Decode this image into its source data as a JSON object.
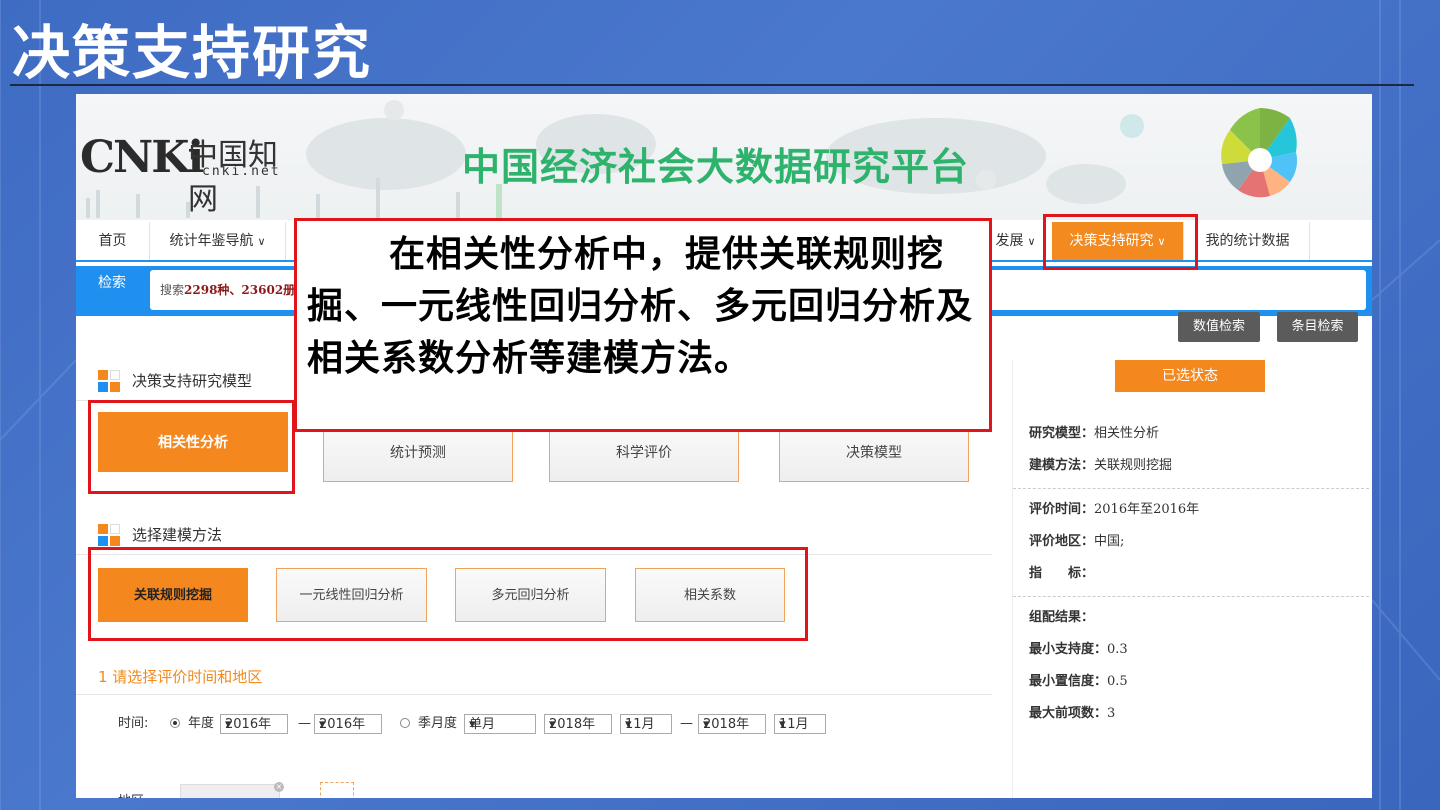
{
  "slide": {
    "title": "决策支持研究"
  },
  "banner": {
    "logo_text": "CNKi",
    "logo_cn": "中国知网",
    "logo_url": "cnki.net",
    "platform_title": "中国经济社会大数据研究平台"
  },
  "nav": {
    "items": [
      {
        "label": "首页",
        "chevron": false
      },
      {
        "label": "统计年鉴导航",
        "chevron": true
      },
      {
        "label": "发展",
        "chevron": true
      },
      {
        "label": "决策支持研究",
        "chevron": true
      },
      {
        "label": "我的统计数据",
        "chevron": false
      }
    ]
  },
  "search": {
    "tab_label": "检索",
    "prefix": "搜索",
    "stats": "2298种、23602册"
  },
  "buttons": {
    "value_search": "数值检索",
    "entry_search": "条目检索"
  },
  "models": {
    "section_title": "决策支持研究模型",
    "items": [
      "相关性分析",
      "统计预测",
      "科学评价",
      "决策模型"
    ]
  },
  "methods": {
    "section_title": "选择建模方法",
    "items": [
      "关联规则挖掘",
      "一元线性回归分析",
      "多元回归分析",
      "相关系数"
    ]
  },
  "step1": {
    "title": "1  请选择评价时间和地区",
    "time_label": "时间:",
    "year_label": "年度",
    "year_from": "2016年",
    "year_to": "2016年",
    "season_label": "季月度",
    "month_type": "单月",
    "s_year_from": "2018年",
    "s_month_from": "11月",
    "s_year_to": "2018年",
    "s_month_to": "11月",
    "dash": "—",
    "region_label": "地区:"
  },
  "status": {
    "header": "已选状态",
    "model_label": "研究模型：",
    "model_value": "相关性分析",
    "method_label": "建模方法：",
    "method_value": "关联规则挖掘",
    "time_label": "评价时间：",
    "time_value": "2016年至2016年",
    "region_label": "评价地区：",
    "region_value": "中国;",
    "indicator_label": "指　　标：",
    "result_label": "组配结果：",
    "min_support_label": "最小支持度：",
    "min_support_value": "0.3",
    "min_conf_label": "最小置信度：",
    "min_conf_value": "0.5",
    "max_items_label": "最大前项数：",
    "max_items_value": "3"
  },
  "callout": {
    "text": "在相关性分析中，提供关联规则挖掘、一元线性回归分析、多元回归分析及相关系数分析等建模方法。"
  },
  "colors": {
    "accent": "#f5871f",
    "nav_blue": "#1f8ff0",
    "highlight_red": "#e0141b",
    "title_green": "#2db36c"
  }
}
